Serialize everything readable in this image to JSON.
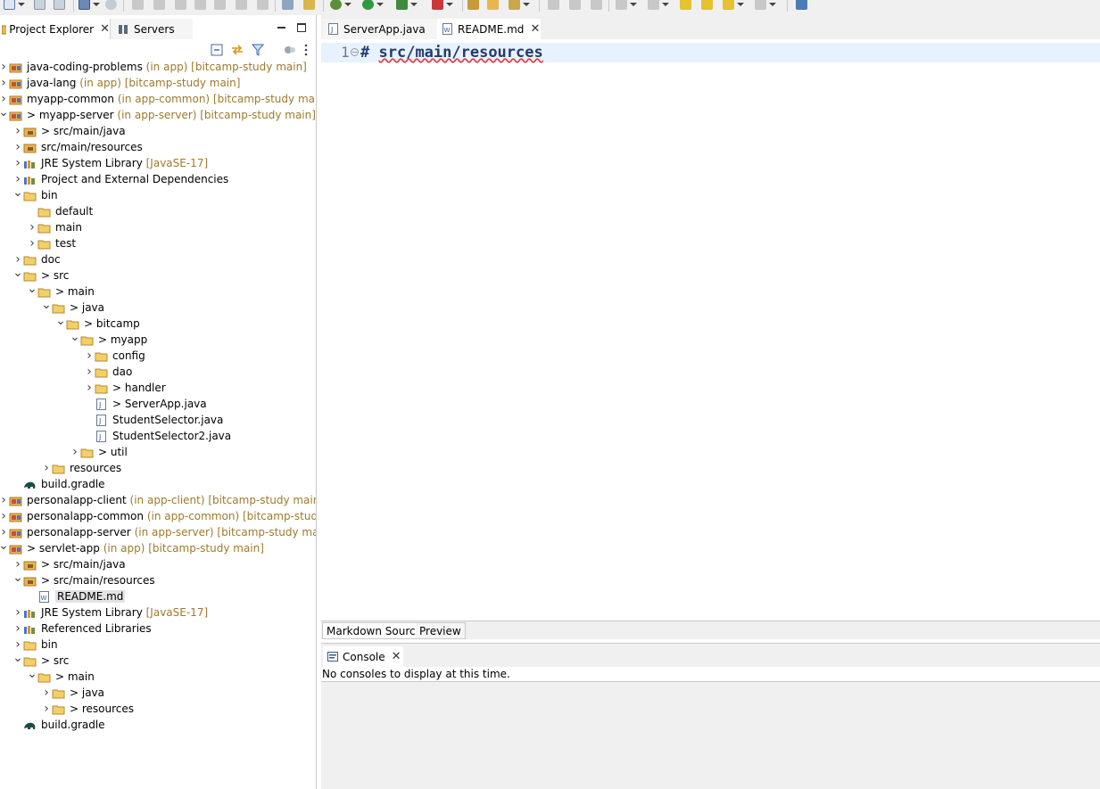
{
  "left_panel": {
    "tabs": [
      {
        "label": "Project Explorer",
        "icon": "project-explorer-icon"
      },
      {
        "label": "Servers",
        "icon": "servers-icon"
      }
    ],
    "tree": [
      {
        "label": "java-coding-problems",
        "decoration": "(in app) [bitcamp-study main]",
        "level": 0,
        "expand": "collapsed",
        "icon": "java-project-icon"
      },
      {
        "label": "java-lang",
        "decoration": "(in app) [bitcamp-study main]",
        "level": 0,
        "expand": "collapsed",
        "icon": "java-project-icon"
      },
      {
        "label": "myapp-common",
        "decoration": "(in app-common) [bitcamp-study main]",
        "level": 0,
        "expand": "collapsed",
        "icon": "java-project-icon"
      },
      {
        "label": "> myapp-server",
        "decoration": "(in app-server) [bitcamp-study main]",
        "level": 0,
        "expand": "expanded",
        "icon": "java-project-icon"
      },
      {
        "label": "> src/main/java",
        "decoration": "",
        "level": 1,
        "expand": "collapsed",
        "icon": "source-folder-icon"
      },
      {
        "label": "src/main/resources",
        "decoration": "",
        "level": 1,
        "expand": "collapsed",
        "icon": "source-folder-icon"
      },
      {
        "label": "JRE System Library",
        "decoration": "[JavaSE-17]",
        "level": 1,
        "expand": "collapsed",
        "icon": "library-icon"
      },
      {
        "label": "Project and External Dependencies",
        "decoration": "",
        "level": 1,
        "expand": "collapsed",
        "icon": "library-icon"
      },
      {
        "label": "bin",
        "decoration": "",
        "level": 1,
        "expand": "expanded",
        "icon": "folder-icon"
      },
      {
        "label": "default",
        "decoration": "",
        "level": 2,
        "expand": "none",
        "icon": "folder-icon"
      },
      {
        "label": "main",
        "decoration": "",
        "level": 2,
        "expand": "collapsed",
        "icon": "folder-icon"
      },
      {
        "label": "test",
        "decoration": "",
        "level": 2,
        "expand": "collapsed",
        "icon": "folder-icon"
      },
      {
        "label": "doc",
        "decoration": "",
        "level": 1,
        "expand": "collapsed",
        "icon": "folder-icon"
      },
      {
        "label": "> src",
        "decoration": "",
        "level": 1,
        "expand": "expanded",
        "icon": "folder-icon"
      },
      {
        "label": "> main",
        "decoration": "",
        "level": 2,
        "expand": "expanded",
        "icon": "folder-icon"
      },
      {
        "label": "> java",
        "decoration": "",
        "level": 3,
        "expand": "expanded",
        "icon": "folder-icon"
      },
      {
        "label": "> bitcamp",
        "decoration": "",
        "level": 4,
        "expand": "expanded",
        "icon": "folder-icon"
      },
      {
        "label": "> myapp",
        "decoration": "",
        "level": 5,
        "expand": "expanded",
        "icon": "folder-icon"
      },
      {
        "label": "config",
        "decoration": "",
        "level": 6,
        "expand": "collapsed",
        "icon": "folder-icon"
      },
      {
        "label": "dao",
        "decoration": "",
        "level": 6,
        "expand": "collapsed",
        "icon": "folder-icon"
      },
      {
        "label": "> handler",
        "decoration": "",
        "level": 6,
        "expand": "collapsed",
        "icon": "folder-icon"
      },
      {
        "label": "> ServerApp.java",
        "decoration": "",
        "level": 6,
        "expand": "none",
        "icon": "java-file-icon"
      },
      {
        "label": "StudentSelector.java",
        "decoration": "",
        "level": 6,
        "expand": "none",
        "icon": "java-file-icon"
      },
      {
        "label": "StudentSelector2.java",
        "decoration": "",
        "level": 6,
        "expand": "none",
        "icon": "java-file-icon"
      },
      {
        "label": "> util",
        "decoration": "",
        "level": 5,
        "expand": "collapsed",
        "icon": "folder-icon"
      },
      {
        "label": "resources",
        "decoration": "",
        "level": 3,
        "expand": "collapsed",
        "icon": "folder-icon"
      },
      {
        "label": "build.gradle",
        "decoration": "",
        "level": 1,
        "expand": "none",
        "icon": "gradle-icon"
      },
      {
        "label": "personalapp-client",
        "decoration": "(in app-client) [bitcamp-study main]",
        "level": 0,
        "expand": "collapsed",
        "icon": "java-project-icon"
      },
      {
        "label": "personalapp-common",
        "decoration": "(in app-common) [bitcamp-study main]",
        "level": 0,
        "expand": "collapsed",
        "icon": "java-project-icon"
      },
      {
        "label": "personalapp-server",
        "decoration": "(in app-server) [bitcamp-study main]",
        "level": 0,
        "expand": "collapsed",
        "icon": "java-project-icon"
      },
      {
        "label": "> servlet-app",
        "decoration": "(in app) [bitcamp-study main]",
        "level": 0,
        "expand": "expanded",
        "icon": "java-project-icon"
      },
      {
        "label": "> src/main/java",
        "decoration": "",
        "level": 1,
        "expand": "collapsed",
        "icon": "source-folder-icon"
      },
      {
        "label": "> src/main/resources",
        "decoration": "",
        "level": 1,
        "expand": "expanded",
        "icon": "source-folder-icon"
      },
      {
        "label": "README.md",
        "decoration": "",
        "level": 2,
        "expand": "none",
        "icon": "markdown-file-icon",
        "selected": true
      },
      {
        "label": "JRE System Library",
        "decoration": "[JavaSE-17]",
        "level": 1,
        "expand": "collapsed",
        "icon": "library-icon"
      },
      {
        "label": "Referenced Libraries",
        "decoration": "",
        "level": 1,
        "expand": "collapsed",
        "icon": "library-icon"
      },
      {
        "label": "bin",
        "decoration": "",
        "level": 1,
        "expand": "collapsed",
        "icon": "folder-icon"
      },
      {
        "label": "> src",
        "decoration": "",
        "level": 1,
        "expand": "expanded",
        "icon": "folder-icon"
      },
      {
        "label": "> main",
        "decoration": "",
        "level": 2,
        "expand": "expanded",
        "icon": "folder-icon"
      },
      {
        "label": "> java",
        "decoration": "",
        "level": 3,
        "expand": "collapsed",
        "icon": "folder-icon"
      },
      {
        "label": "> resources",
        "decoration": "",
        "level": 3,
        "expand": "collapsed",
        "icon": "folder-icon"
      },
      {
        "label": "build.gradle",
        "decoration": "",
        "level": 1,
        "expand": "none",
        "icon": "gradle-icon"
      }
    ]
  },
  "editor": {
    "tabs": [
      {
        "label": "ServerApp.java",
        "icon": "java-file-icon"
      },
      {
        "label": "README.md",
        "icon": "markdown-file-icon"
      }
    ],
    "line_number": "1",
    "code_hash": "#",
    "code_text": "src/main/resources",
    "mode_tabs": [
      "Markdown Source",
      "Preview"
    ]
  },
  "console": {
    "tab_label": "Console",
    "message": "No consoles to display at this time."
  },
  "colors": {
    "decoration": "#9d7a2c",
    "code": "#233b6c",
    "current_line": "#e8f2fe",
    "folder": "#e8b64c"
  }
}
